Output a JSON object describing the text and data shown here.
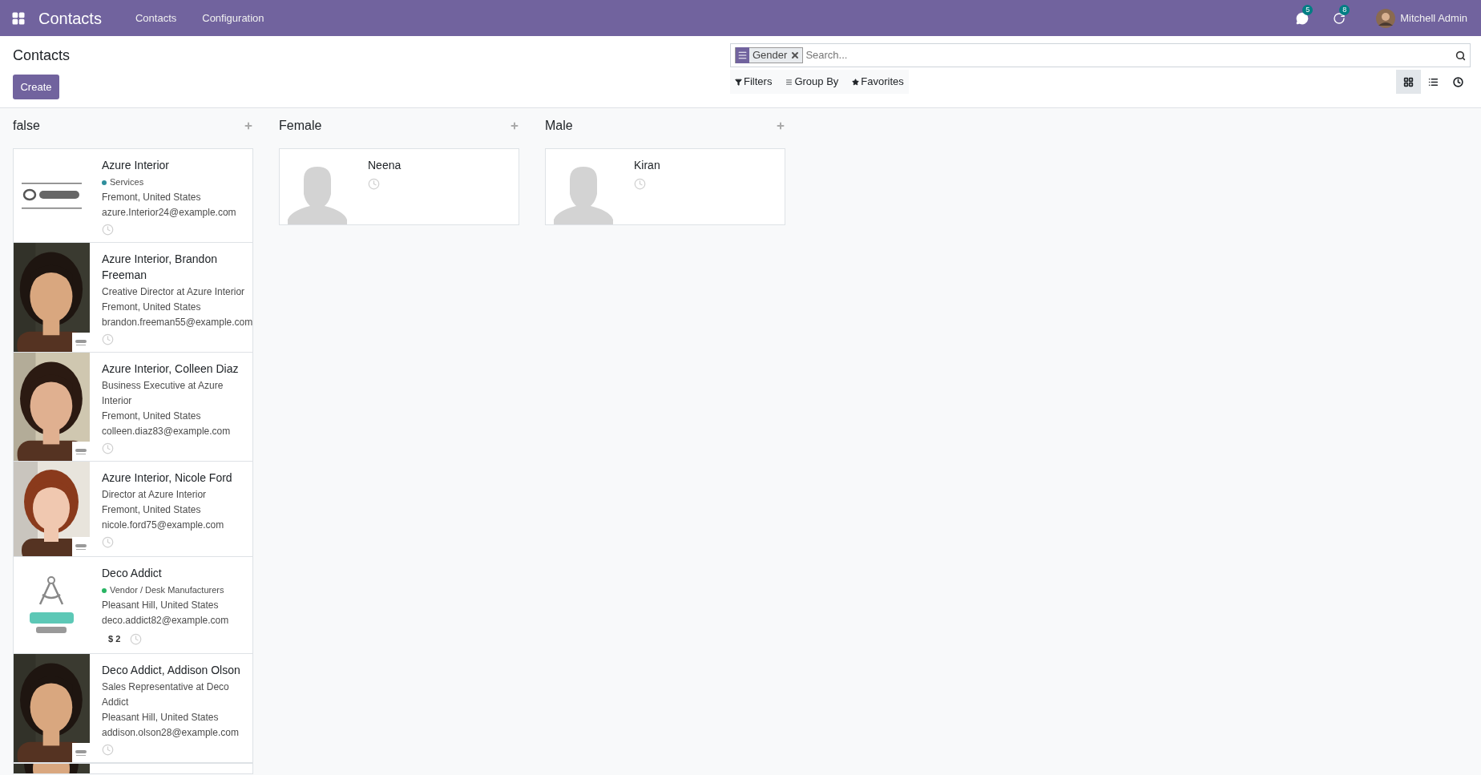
{
  "navbar": {
    "app_title": "Contacts",
    "menu": [
      "Contacts",
      "Configuration"
    ],
    "messages_count": "5",
    "activities_count": "8",
    "user": "Mitchell Admin"
  },
  "control_panel": {
    "breadcrumb": "Contacts",
    "create_button": "Create",
    "search": {
      "facet": "Gender",
      "placeholder": "Search..."
    },
    "filters": [
      "Filters",
      "Group By",
      "Favorites"
    ],
    "views": [
      {
        "kind": "kanban",
        "selected": true
      },
      {
        "kind": "list",
        "selected": false
      },
      {
        "kind": "activity",
        "selected": false
      }
    ]
  },
  "columns": [
    {
      "title": "false",
      "cards": [
        {
          "kind": "logo",
          "name": "Azure Interior",
          "tag": {
            "label": "Services",
            "color": "#2f8f9d"
          },
          "lines": [
            "Fremont, United States",
            "azure.Interior24@example.com"
          ]
        },
        {
          "company_badge": true,
          "name": "Azure Interior, Brandon Freeman",
          "lines": [
            "Creative Director at Azure Interior",
            "Fremont, United States",
            "brandon.freeman55@example.com"
          ]
        },
        {
          "company_badge": true,
          "name": "Azure Interior, Colleen Diaz",
          "lines": [
            "Business Executive at Azure Interior",
            "Fremont, United States",
            "colleen.diaz83@example.com"
          ]
        },
        {
          "company_badge": true,
          "name": "Azure Interior, Nicole Ford",
          "lines": [
            "Director at Azure Interior",
            "Fremont, United States",
            "nicole.ford75@example.com"
          ]
        },
        {
          "kind": "logo",
          "name": "Deco Addict",
          "tag": {
            "label": "Vendor / Desk Manufacturers",
            "color": "#28b463"
          },
          "lines": [
            "Pleasant Hill, United States",
            "deco.addict82@example.com"
          ],
          "badge": "$ 2"
        },
        {
          "company_badge": true,
          "name": "Deco Addict, Addison Olson",
          "lines": [
            "Sales Representative at Deco Addict",
            "Pleasant Hill, United States",
            "addison.olson28@example.com"
          ]
        },
        {
          "kind": "stub"
        }
      ]
    },
    {
      "title": "Female",
      "cards": [
        {
          "kind": "placeholder",
          "name": "Neena"
        }
      ]
    },
    {
      "title": "Male",
      "cards": [
        {
          "kind": "placeholder",
          "name": "Kiran"
        }
      ]
    }
  ]
}
